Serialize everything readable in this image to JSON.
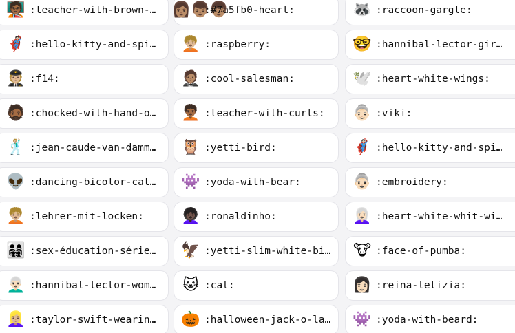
{
  "rows": [
    [
      {
        "icon": "🧑🏾‍🏫",
        "icon_name": "teacher-icon",
        "label": ":teacher-with-brown-…"
      },
      {
        "icon": "👩🏽‍👩🏽‍👦🏽‍👦🏽",
        "icon_name": "family-icon",
        "label": ":#7a5fb0-heart:"
      },
      {
        "icon": "🦝",
        "icon_name": "raccoon-icon",
        "label": ":raccoon-gargle:"
      }
    ],
    [
      {
        "icon": "🦸🏻",
        "icon_name": "superhero-icon",
        "label": ":hello-kitty-and-spi…"
      },
      {
        "icon": "🧑🏼‍🦱",
        "icon_name": "curly-hair-person-icon",
        "label": ":raspberry:"
      },
      {
        "icon": "🤓",
        "icon_name": "glasses-face-icon",
        "label": ":hannibal-lector-gir…"
      }
    ],
    [
      {
        "icon": "🧑🏼‍✈️",
        "icon_name": "pilot-icon",
        "label": ":f14:"
      },
      {
        "icon": "🤵🏽",
        "icon_name": "man-in-tuxedo-icon",
        "label": ":cool-salesman:"
      },
      {
        "icon": "🕊️",
        "icon_name": "white-wings-icon",
        "label": ":heart-white-wings:"
      }
    ],
    [
      {
        "icon": "🧔🏾",
        "icon_name": "man-dark-skin-icon",
        "label": ":chocked-with-hand-o…"
      },
      {
        "icon": "🧑🏾‍🦱",
        "icon_name": "person-curly-hair-icon",
        "label": ":teacher-with-curls:"
      },
      {
        "icon": "👵🏻",
        "icon_name": "older-person-icon",
        "label": ":viki:"
      }
    ],
    [
      {
        "icon": "🕺🏼",
        "icon_name": "muscular-man-icon",
        "label": ":jean-caude-van-damm…"
      },
      {
        "icon": "🦉",
        "icon_name": "owl-icon",
        "label": ":yetti-bird:"
      },
      {
        "icon": "🦸🏻",
        "icon_name": "superheroes-icon",
        "label": ":hello-kitty-and-spi…"
      }
    ],
    [
      {
        "icon": "👽",
        "icon_name": "alien-icon",
        "label": ":dancing-bicolor-cat…"
      },
      {
        "icon": "👾",
        "icon_name": "yoda-icon",
        "label": ":yoda-with-bear:"
      },
      {
        "icon": "👵🏻",
        "icon_name": "grandma-icon",
        "label": ":embroidery:"
      }
    ],
    [
      {
        "icon": "🧑🏼‍🦱",
        "icon_name": "curly-blond-person-icon",
        "label": ":lehrer-mit-locken:"
      },
      {
        "icon": "👩🏿‍🦱",
        "icon_name": "long-hair-person-icon",
        "label": ":ronaldinho:"
      },
      {
        "icon": "👩🏻‍🦳",
        "icon_name": "white-hair-woman-icon",
        "label": ":heart-white-whit-wi…"
      }
    ],
    [
      {
        "icon": "👨‍👩‍👧‍👦",
        "icon_name": "group-icon",
        "label": ":sex-éducation-série…"
      },
      {
        "icon": "🦅",
        "icon_name": "white-bird-icon",
        "label": ":yetti-slim-white-bi…"
      },
      {
        "icon": "🐮",
        "icon_name": "pumba-face-icon",
        "label": ":face-of-pumba:"
      }
    ],
    [
      {
        "icon": "👨🏻‍🦳",
        "icon_name": "white-hair-man-icon",
        "label": ":hannibal-lector-wom…"
      },
      {
        "icon": "🐱",
        "icon_name": "cat-icon",
        "label": ":cat:"
      },
      {
        "icon": "👩🏻",
        "icon_name": "woman-icon",
        "label": ":reina-letizia:"
      }
    ],
    [
      {
        "icon": "👱🏼‍♀️",
        "icon_name": "blond-woman-icon",
        "label": ":taylor-swift-wearin…"
      },
      {
        "icon": "🎃",
        "icon_name": "jack-o-lantern-icon",
        "label": ":halloween-jack-o-la…"
      },
      {
        "icon": "👾",
        "icon_name": "bearded-yoda-icon",
        "label": ":yoda-with-beard:"
      }
    ]
  ]
}
